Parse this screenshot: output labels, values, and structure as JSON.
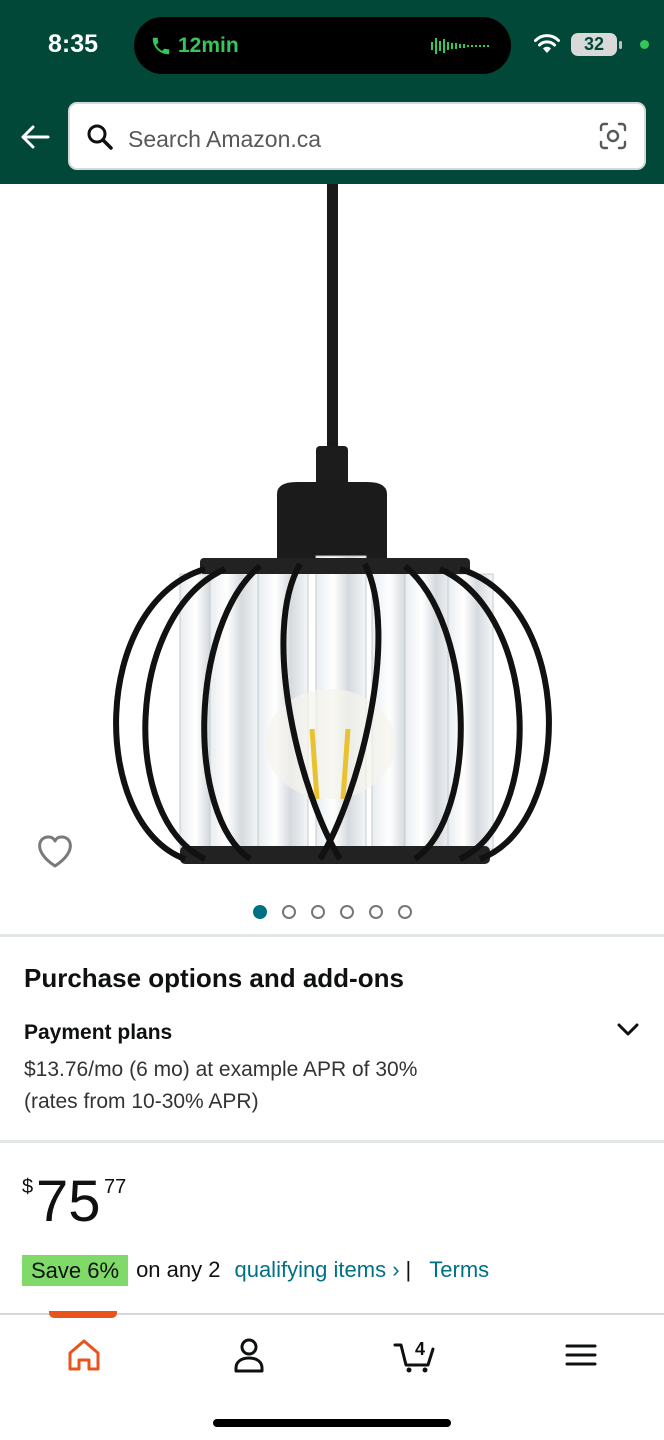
{
  "status_bar": {
    "time": "8:35",
    "call_duration": "12min",
    "battery": "32"
  },
  "header": {
    "search_placeholder": "Search Amazon.ca"
  },
  "product": {
    "image_count": 6,
    "active_image": 1
  },
  "purchase_options": {
    "title": "Purchase options and add-ons",
    "payment_plans_label": "Payment plans",
    "plan_line1": "$13.76/mo (6 mo) at example APR of 30%",
    "plan_line2": "(rates from 10-30% APR)"
  },
  "price": {
    "currency": "$",
    "whole": "75",
    "fraction": "77"
  },
  "promotion": {
    "badge": "Save 6%",
    "text": "on any 2",
    "link": "qualifying items ›",
    "separator": "|",
    "terms": "Terms"
  },
  "tabs": [
    "home",
    "account",
    "cart",
    "menu"
  ],
  "cart_count": "4",
  "colors": {
    "header_bg": "#024838",
    "link": "#007185",
    "save_badge": "#7fda69",
    "active_tab": "#e8541c"
  }
}
